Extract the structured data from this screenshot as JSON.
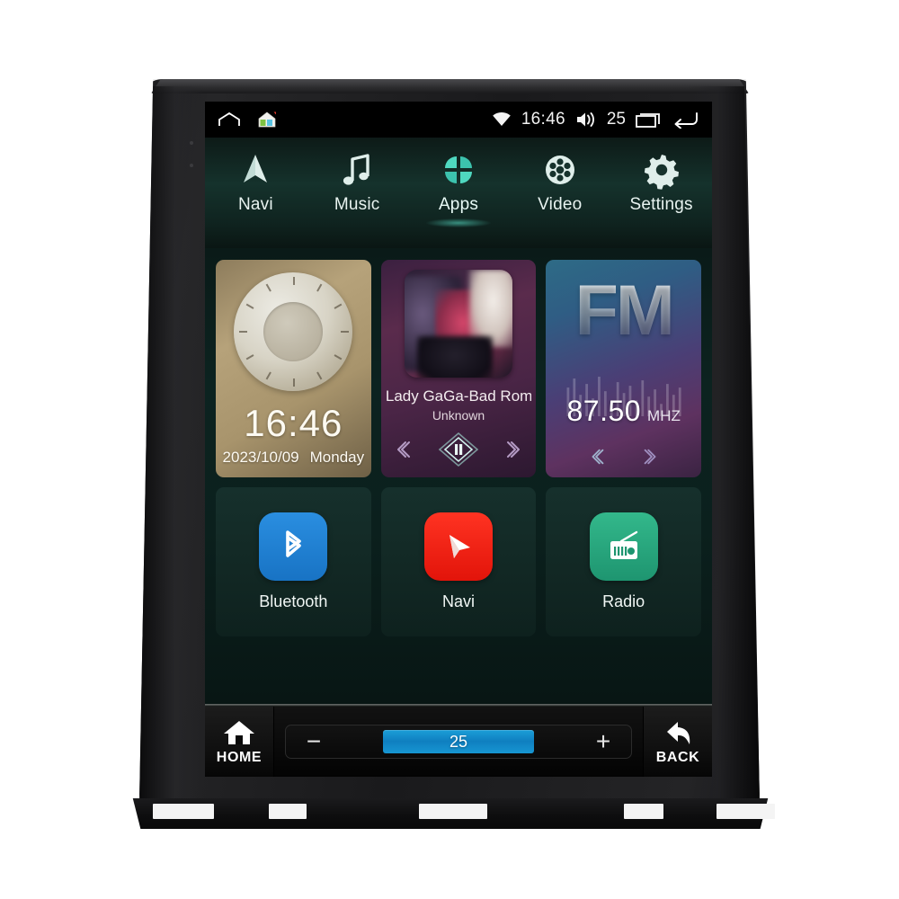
{
  "status_bar": {
    "left_icons": [
      {
        "name": "arch-home-icon",
        "label": "home"
      },
      {
        "name": "house-launcher-icon",
        "label": "launcher"
      }
    ],
    "wifi_icon": "wifi-icon",
    "time": "16:46",
    "volume_icon": "volume-icon",
    "volume_value": "25",
    "recents_icon": "recents-icon",
    "back_icon": "back-arrow-icon"
  },
  "nav_tabs": [
    {
      "id": "navi",
      "label": "Navi",
      "icon": "navigation-arrow-icon",
      "active": false
    },
    {
      "id": "music",
      "label": "Music",
      "icon": "music-note-icon",
      "active": false
    },
    {
      "id": "apps",
      "label": "Apps",
      "icon": "apps-clover-icon",
      "active": true
    },
    {
      "id": "video",
      "label": "Video",
      "icon": "film-reel-icon",
      "active": false
    },
    {
      "id": "settings",
      "label": "Settings",
      "icon": "gear-icon",
      "active": false
    }
  ],
  "widgets": {
    "clock": {
      "time": "16:46",
      "date": "2023/10/09",
      "weekday": "Monday"
    },
    "music": {
      "title": "Lady GaGa-Bad Rom...",
      "artist": "Unknown",
      "prev_icon": "previous-track-icon",
      "play_pause_icon": "pause-icon",
      "next_icon": "next-track-icon"
    },
    "fm": {
      "band": "FM",
      "frequency": "87.50",
      "unit": "MHZ",
      "prev_icon": "tune-down-icon",
      "next_icon": "tune-up-icon"
    }
  },
  "apps": [
    {
      "id": "bluetooth",
      "label": "Bluetooth",
      "icon": "bluetooth-icon",
      "color": "#1f7fd4"
    },
    {
      "id": "navi",
      "label": "Navi",
      "icon": "navi-cursor-icon",
      "color": "#f01f11"
    },
    {
      "id": "radio",
      "label": "Radio",
      "icon": "radio-icon",
      "color": "#27a37a"
    }
  ],
  "bottom_bar": {
    "home_label": "HOME",
    "home_icon": "home-icon",
    "back_label": "BACK",
    "back_icon": "back-curved-arrow-icon",
    "volume": {
      "minus_label": "−",
      "plus_label": "+",
      "value": "25"
    }
  },
  "colors": {
    "accent_teal": "#4fd8c0",
    "volume_blue": "#0f7fc0",
    "screen_bg": "#0b201d"
  }
}
